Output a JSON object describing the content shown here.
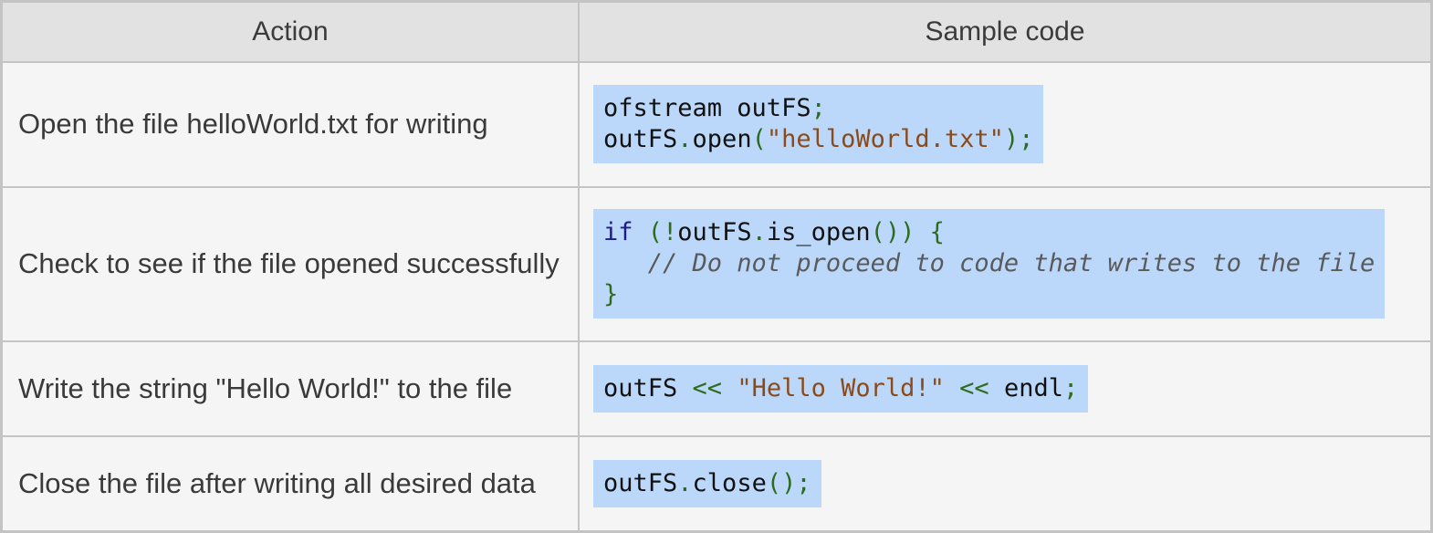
{
  "table": {
    "headers": {
      "action": "Action",
      "code": "Sample code"
    },
    "rows": [
      {
        "action": "Open the file helloWorld.txt for writing",
        "code": {
          "line1": {
            "a": "ofstream outFS",
            "b": ";"
          },
          "line2": {
            "a": "outFS",
            "b": ".",
            "c": "open",
            "d": "(",
            "e": "\"helloWorld.txt\"",
            "f": ");"
          }
        }
      },
      {
        "action": "Check to see if the file opened successfully",
        "code": {
          "line1": {
            "a": "if",
            "b": " (!",
            "c": "outFS",
            "d": ".",
            "e": "is_open",
            "f": "()) {"
          },
          "line2": {
            "a": "   // Do not proceed to code that writes to the file"
          },
          "line3": {
            "a": "}"
          }
        }
      },
      {
        "action": "Write the string \"Hello World!\" to the file",
        "code": {
          "line1": {
            "a": "outFS ",
            "b": "<<",
            "c": " ",
            "d": "\"Hello World!\"",
            "e": " << ",
            "f": "endl",
            "g": ";"
          }
        }
      },
      {
        "action": "Close the file after writing all desired data",
        "code": {
          "line1": {
            "a": "outFS",
            "b": ".",
            "c": "close",
            "d": "();"
          }
        }
      }
    ]
  }
}
